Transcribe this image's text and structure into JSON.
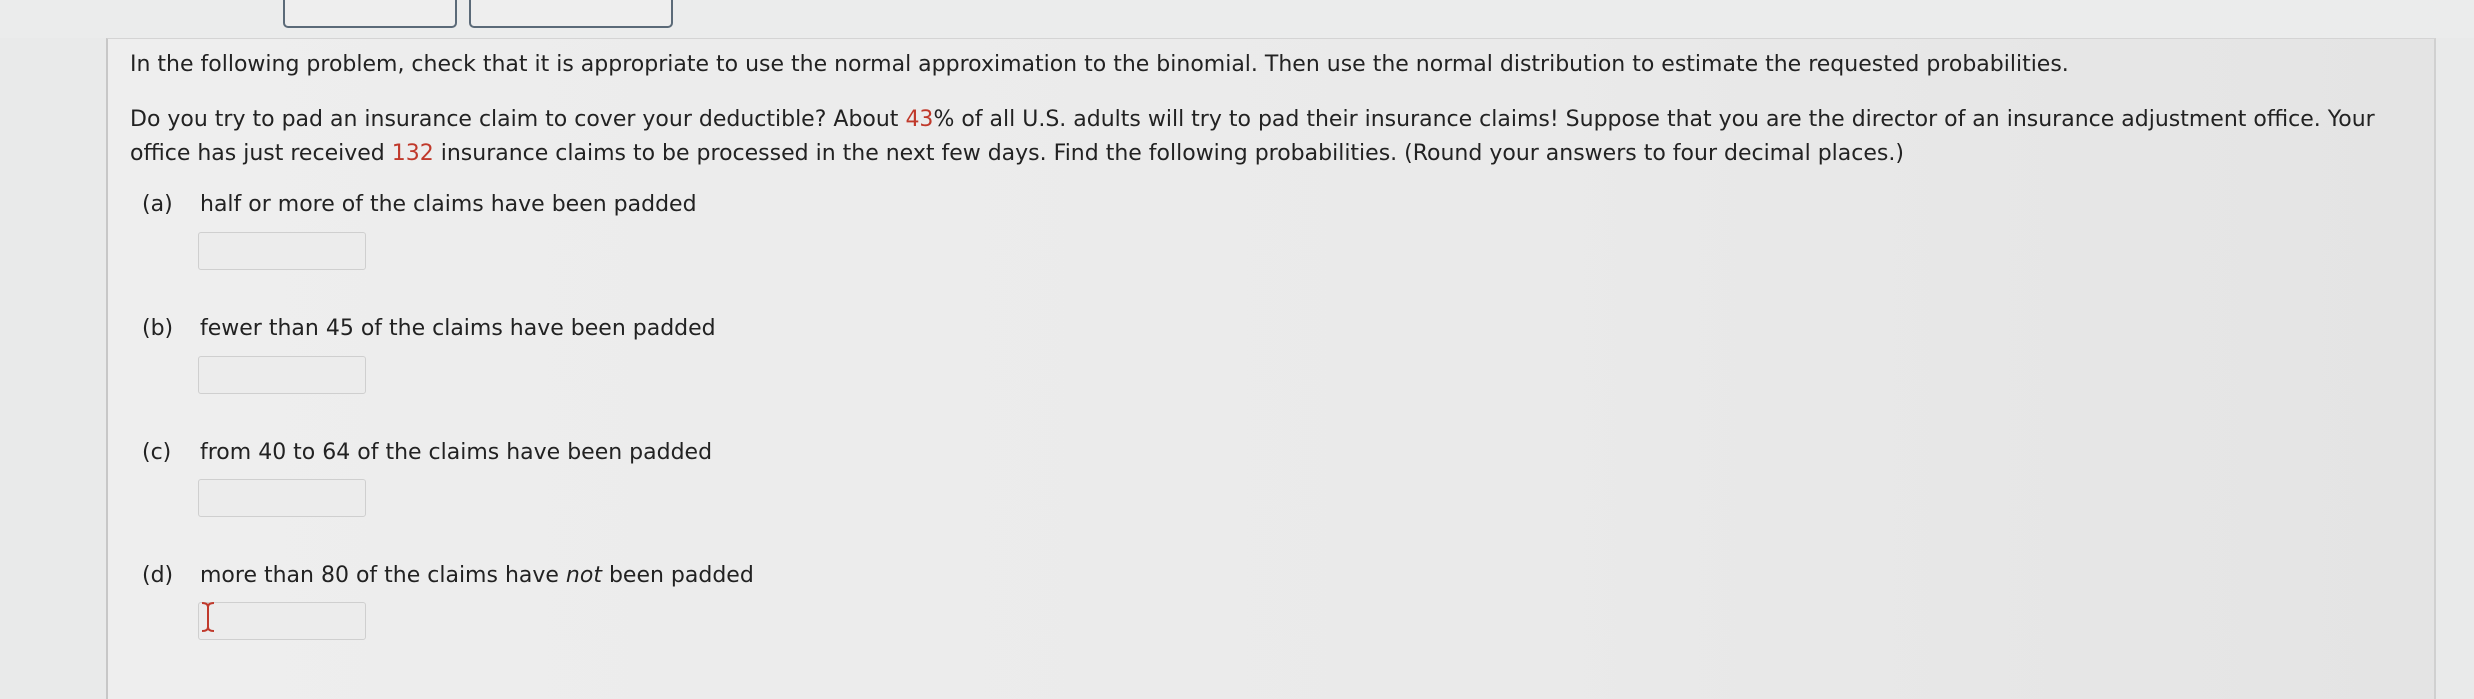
{
  "instructions": "In the following problem, check that it is appropriate to use the normal approximation to the binomial. Then use the normal distribution to estimate the requested probabilities.",
  "problem": {
    "part1": "Do you try to pad an insurance claim to cover your deductible? About ",
    "percent": "43",
    "part2": "% of all U.S. adults will try to pad their insurance claims! Suppose that you are the director of an insurance adjustment office. Your office has just received ",
    "claims": "132",
    "part3": " insurance claims to be processed in the next few days. Find the following probabilities. (Round your answers to four decimal places.)"
  },
  "parts": [
    {
      "letter": "(a)",
      "text": "half or more of the claims have been padded"
    },
    {
      "letter": "(b)",
      "text": "fewer than 45 of the claims have been padded"
    },
    {
      "letter": "(c)",
      "text": "from 40 to 64 of the claims have been padded"
    },
    {
      "letter": "(d)",
      "text_before": "more than 80 of the claims have ",
      "text_italic": "not",
      "text_after": " been padded"
    }
  ],
  "colors": {
    "highlight": "#c0392b",
    "cursor": "#c0392b"
  },
  "icons": {
    "cursor": "text-cursor-icon"
  }
}
